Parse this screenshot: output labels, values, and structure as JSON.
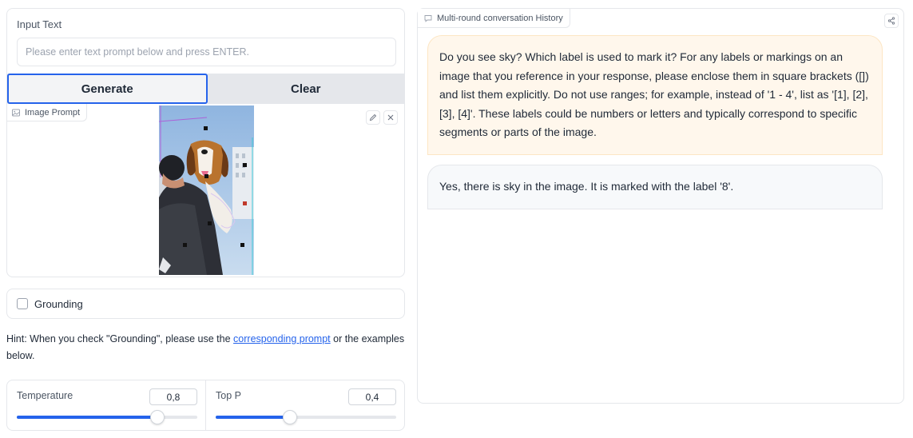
{
  "input": {
    "label": "Input Text",
    "placeholder": "Please enter text prompt below and press ENTER."
  },
  "buttons": {
    "generate": "Generate",
    "clear": "Clear"
  },
  "image_prompt": {
    "label": "Image Prompt",
    "edit_icon": "pencil-icon",
    "close_icon": "close-icon"
  },
  "grounding": {
    "label": "Grounding",
    "checked": false
  },
  "hint": {
    "prefix": "Hint: When you check \"Grounding\", please use the ",
    "link": "corresponding prompt",
    "suffix": " or the examples below."
  },
  "sliders": {
    "temperature": {
      "label": "Temperature",
      "value": "0,8",
      "fraction": 0.8
    },
    "top_p": {
      "label": "Top P",
      "value": "0,4",
      "fraction": 0.4
    }
  },
  "chat": {
    "label": "Multi-round conversation History",
    "messages": [
      {
        "role": "user",
        "text": "Do you see sky? Which label is used to mark it? For any labels or markings on an image that you reference in your response, please enclose them in square brackets ([]) and list them explicitly. Do not use ranges; for example, instead of '1 - 4', list as '[1], [2], [3], [4]'. These labels could be numbers or letters and typically correspond to specific segments or parts of the image."
      },
      {
        "role": "bot",
        "text": "Yes, there is sky in the image. It is marked with the label '8'."
      }
    ]
  },
  "colors": {
    "accent": "#2563eb",
    "user_bubble": "#fff7ec",
    "bot_bubble": "#f7f9fb"
  }
}
